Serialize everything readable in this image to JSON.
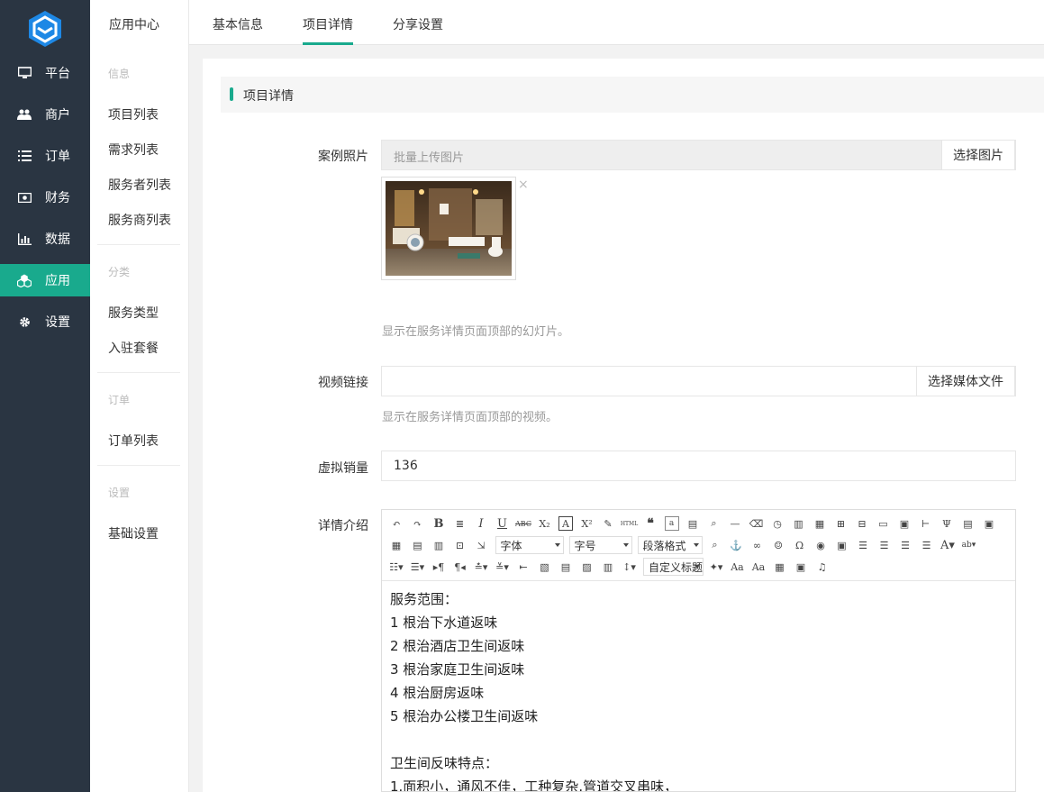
{
  "nav1": {
    "items": [
      {
        "label": "平台",
        "icon": "monitor-icon"
      },
      {
        "label": "商户",
        "icon": "users-icon"
      },
      {
        "label": "订单",
        "icon": "list-icon"
      },
      {
        "label": "财务",
        "icon": "money-icon"
      },
      {
        "label": "数据",
        "icon": "bar-chart-icon"
      },
      {
        "label": "应用",
        "icon": "apps-icon",
        "active": true
      },
      {
        "label": "设置",
        "icon": "gear-icon"
      }
    ]
  },
  "nav2": {
    "title": "应用中心",
    "groups": [
      {
        "label": "信息",
        "items": [
          "项目列表",
          "需求列表",
          "服务者列表",
          "服务商列表"
        ]
      },
      {
        "label": "分类",
        "items": [
          "服务类型",
          "入驻套餐"
        ]
      },
      {
        "label": "订单",
        "items": [
          "订单列表"
        ]
      },
      {
        "label": "设置",
        "items": [
          "基础设置"
        ]
      }
    ]
  },
  "tabs": [
    "基本信息",
    "项目详情",
    "分享设置"
  ],
  "active_tab": "项目详情",
  "section_title": "项目详情",
  "form": {
    "photos": {
      "label": "案例照片",
      "placeholder": "批量上传图片",
      "button": "选择图片",
      "help": "显示在服务详情页面顶部的幻灯片。",
      "remove": "×"
    },
    "video": {
      "label": "视频链接",
      "value": "",
      "button": "选择媒体文件",
      "help": "显示在服务详情页面顶部的视频。"
    },
    "sales": {
      "label": "虚拟销量",
      "value": "136"
    },
    "detail": {
      "label": "详情介绍",
      "toolbar_selects": {
        "font": "字体",
        "size": "字号",
        "paragraph": "段落格式",
        "custom_title": "自定义标题"
      },
      "content": [
        "服务范围：",
        "1 根治下水道返味",
        "2 根治酒店卫生间返味",
        "3 根治家庭卫生间返味",
        "4 根治厨房返味",
        "5 根治办公楼卫生间返味",
        "",
        "卫生间反味特点：",
        "1.面积小，通风不佳，工种复杂.管道交叉串味，"
      ]
    }
  },
  "colors": {
    "accent": "#19aa8d",
    "sidebar": "#2a3542"
  }
}
